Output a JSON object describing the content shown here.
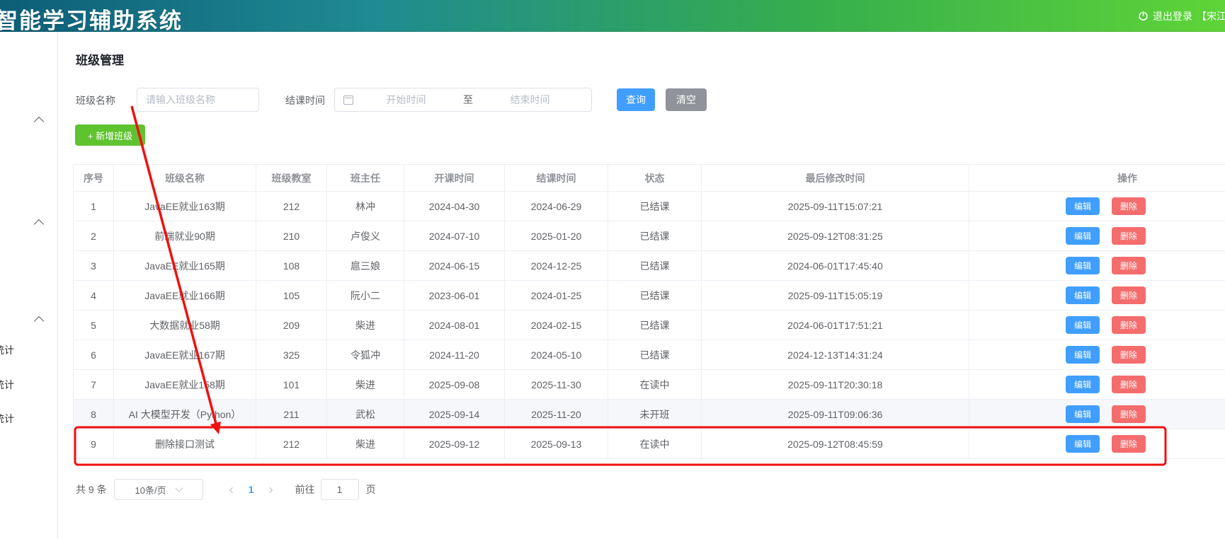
{
  "header": {
    "title": "智能学习辅助系统",
    "logout_label": "退出登录",
    "user_label": "【宋江】"
  },
  "sidebar": {
    "items": [
      {
        "label": "统计"
      },
      {
        "label": "统计"
      },
      {
        "label": "统计"
      }
    ]
  },
  "page": {
    "title": "班级管理"
  },
  "filters": {
    "class_name_label": "班级名称",
    "class_name_placeholder": "请输入班级名称",
    "end_time_label": "结课时间",
    "start_placeholder": "开始时间",
    "to_label": "至",
    "end_placeholder": "结束时间",
    "search_button": "查询",
    "clear_button": "清空",
    "add_button": "+ 新增班级"
  },
  "table": {
    "columns": [
      "序号",
      "班级名称",
      "班级教室",
      "班主任",
      "开课时间",
      "结课时间",
      "状态",
      "最后修改时间",
      "操作"
    ],
    "edit_label": "编辑",
    "delete_label": "删除",
    "rows": [
      {
        "no": "1",
        "name": "JavaEE就业163期",
        "room": "212",
        "teacher": "林冲",
        "start": "2024-04-30",
        "end": "2024-06-29",
        "status": "已结课",
        "modified": "2025-09-11T15:07:21"
      },
      {
        "no": "2",
        "name": "前端就业90期",
        "room": "210",
        "teacher": "卢俊义",
        "start": "2024-07-10",
        "end": "2025-01-20",
        "status": "已结课",
        "modified": "2025-09-12T08:31:25"
      },
      {
        "no": "3",
        "name": "JavaEE就业165期",
        "room": "108",
        "teacher": "扈三娘",
        "start": "2024-06-15",
        "end": "2024-12-25",
        "status": "已结课",
        "modified": "2024-06-01T17:45:40"
      },
      {
        "no": "4",
        "name": "JavaEE就业166期",
        "room": "105",
        "teacher": "阮小二",
        "start": "2023-06-01",
        "end": "2024-01-25",
        "status": "已结课",
        "modified": "2025-09-11T15:05:19"
      },
      {
        "no": "5",
        "name": "大数据就业58期",
        "room": "209",
        "teacher": "柴进",
        "start": "2024-08-01",
        "end": "2024-02-15",
        "status": "已结课",
        "modified": "2024-06-01T17:51:21"
      },
      {
        "no": "6",
        "name": "JavaEE就业167期",
        "room": "325",
        "teacher": "令狐冲",
        "start": "2024-11-20",
        "end": "2024-05-10",
        "status": "已结课",
        "modified": "2024-12-13T14:31:24"
      },
      {
        "no": "7",
        "name": "JavaEE就业158期",
        "room": "101",
        "teacher": "柴进",
        "start": "2025-09-08",
        "end": "2025-11-30",
        "status": "在读中",
        "modified": "2025-09-11T20:30:18"
      },
      {
        "no": "8",
        "name": "AI 大模型开发（Python）",
        "room": "211",
        "teacher": "武松",
        "start": "2025-09-14",
        "end": "2025-11-20",
        "status": "未开班",
        "modified": "2025-09-11T09:06:36",
        "highlighted": true
      },
      {
        "no": "9",
        "name": "删除接口测试",
        "room": "212",
        "teacher": "柴进",
        "start": "2025-09-12",
        "end": "2025-09-13",
        "status": "在读中",
        "modified": "2025-09-12T08:45:59",
        "annotated": true
      }
    ]
  },
  "pagination": {
    "total": "共 9 条",
    "page_size": "10条/页",
    "prev": "‹",
    "current_page": "1",
    "next": "›",
    "goto_label": "前往",
    "goto_value": "1",
    "page_label": "页"
  },
  "colors": {
    "accent_blue": "#409EFF",
    "success_green": "#5fc22f",
    "neutral_gray": "#909399",
    "danger_red": "#F56C6C",
    "annotation_red": "#f01010",
    "header_gradient_start": "#0d5e78",
    "header_gradient_end": "#5ed437"
  }
}
